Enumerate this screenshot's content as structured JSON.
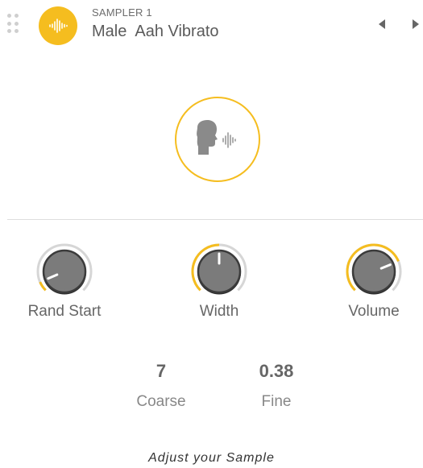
{
  "header": {
    "subtitle": "SAMPLER 1",
    "title": "Male  Aah Vibrato"
  },
  "accent_color": "#f5bd1f",
  "icons": {
    "logo": "waveform-icon",
    "center": "voice-head-icon",
    "prev": "triangle-left-icon",
    "next": "triangle-right-icon",
    "drag": "drag-handle-icon"
  },
  "knobs": [
    {
      "label": "Rand Start",
      "value_fraction": 0.08
    },
    {
      "label": "Width",
      "value_fraction": 0.5
    },
    {
      "label": "Volume",
      "value_fraction": 0.75
    }
  ],
  "values": {
    "coarse": {
      "value": "7",
      "label": "Coarse"
    },
    "fine": {
      "value": "0.38",
      "label": "Fine"
    }
  },
  "footer": "Adjust your Sample"
}
